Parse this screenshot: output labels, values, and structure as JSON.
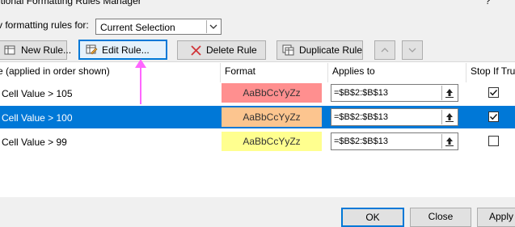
{
  "dialog": {
    "title": "itional Formatting Rules Manager",
    "help": "?"
  },
  "show_rules": {
    "label": "v formatting rules for:",
    "value": "Current Selection"
  },
  "toolbar": {
    "new_rule": "New Rule...",
    "edit_rule": "Edit Rule...",
    "delete_rule": "Delete Rule",
    "duplicate_rule": "Duplicate Rule"
  },
  "columns": {
    "rule": "e (applied in order shown)",
    "format": "Format",
    "applies_to": "Applies to",
    "stop_if_true": "Stop If True"
  },
  "rules": [
    {
      "condition": "Cell Value > 105",
      "preview": "AaBbCcYyZz",
      "fill": "#ff8f8f",
      "applies_to": "=$B$2:$B$13",
      "stop_if_true": true,
      "selected": false
    },
    {
      "condition": "Cell Value > 100",
      "preview": "AaBbCcYyZz",
      "fill": "#fcc58f",
      "applies_to": "=$B$2:$B$13",
      "stop_if_true": true,
      "selected": true
    },
    {
      "condition": "Cell Value > 99",
      "preview": "AaBbCcYyZz",
      "fill": "#ffff8f",
      "applies_to": "=$B$2:$B$13",
      "stop_if_true": false,
      "selected": false
    }
  ],
  "footer": {
    "ok": "OK",
    "close": "Close",
    "apply": "Apply"
  },
  "colors": {
    "accent": "#0078d7",
    "annotation_arrow": "#ff66ff"
  }
}
